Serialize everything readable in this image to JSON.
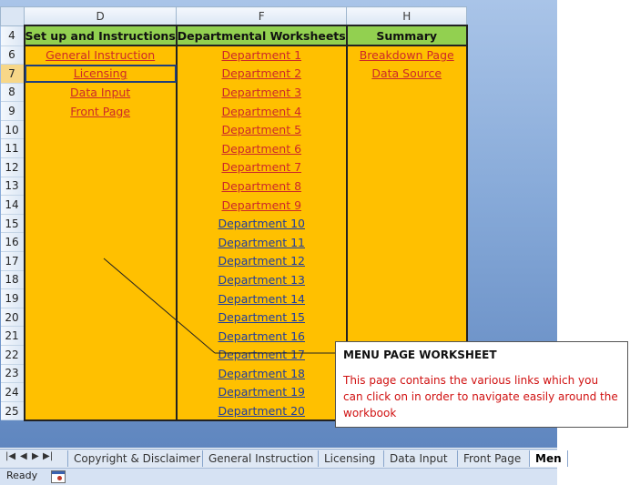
{
  "columns": {
    "d": "D",
    "f": "F",
    "h": "H"
  },
  "headers": {
    "row": "4",
    "d": "Set up and Instructions",
    "f": "Departmental Worksheets",
    "h": "Summary"
  },
  "rows": [
    {
      "num": "6",
      "d": "General Instruction",
      "f": "Department 1",
      "h": "Breakdown Page"
    },
    {
      "num": "7",
      "d": "Licensing",
      "f": "Department 2",
      "h": "Data Source"
    },
    {
      "num": "8",
      "d": "Data Input",
      "f": "Department 3",
      "h": ""
    },
    {
      "num": "9",
      "d": "Front Page",
      "f": "Department 4",
      "h": ""
    },
    {
      "num": "10",
      "d": "",
      "f": "Department 5",
      "h": ""
    },
    {
      "num": "11",
      "d": "",
      "f": "Department 6",
      "h": ""
    },
    {
      "num": "12",
      "d": "",
      "f": "Department 7",
      "h": ""
    },
    {
      "num": "13",
      "d": "",
      "f": "Department 8",
      "h": ""
    },
    {
      "num": "14",
      "d": "",
      "f": "Department 9",
      "h": ""
    },
    {
      "num": "15",
      "d": "",
      "f": "Department 10",
      "h": ""
    },
    {
      "num": "16",
      "d": "",
      "f": "Department 11",
      "h": ""
    },
    {
      "num": "17",
      "d": "",
      "f": "Department 12",
      "h": ""
    },
    {
      "num": "18",
      "d": "",
      "f": "Department 13",
      "h": ""
    },
    {
      "num": "19",
      "d": "",
      "f": "Department 14",
      "h": ""
    },
    {
      "num": "20",
      "d": "",
      "f": "Department 15",
      "h": ""
    },
    {
      "num": "21",
      "d": "",
      "f": "Department 16",
      "h": ""
    },
    {
      "num": "22",
      "d": "",
      "f": "Department 17",
      "h": ""
    },
    {
      "num": "23",
      "d": "",
      "f": "Department 18",
      "h": ""
    },
    {
      "num": "24",
      "d": "",
      "f": "Department 19",
      "h": ""
    },
    {
      "num": "25",
      "d": "",
      "f": "Department 20",
      "h": ""
    }
  ],
  "callout": {
    "title": "MENU PAGE WORKSHEET",
    "body": "This page contains the various links which you can click on in order to navigate easily around the workbook"
  },
  "sheet_tabs": [
    "Copyright & Disclaimer",
    "General Instruction",
    "Licensing",
    "Data Input",
    "Front Page",
    "Men"
  ],
  "active_tab": "Men",
  "status": {
    "ready": "Ready"
  },
  "colors": {
    "cell_fill": "#ffc000",
    "header_fill": "#92d050",
    "visited_link": "#cc2929",
    "link": "#1f3c9e",
    "callout_text": "#d01010"
  },
  "icons": {
    "tab_nav": [
      "first-sheet-icon",
      "prev-sheet-icon",
      "next-sheet-icon",
      "last-sheet-icon"
    ],
    "status": "macro-record-icon"
  }
}
